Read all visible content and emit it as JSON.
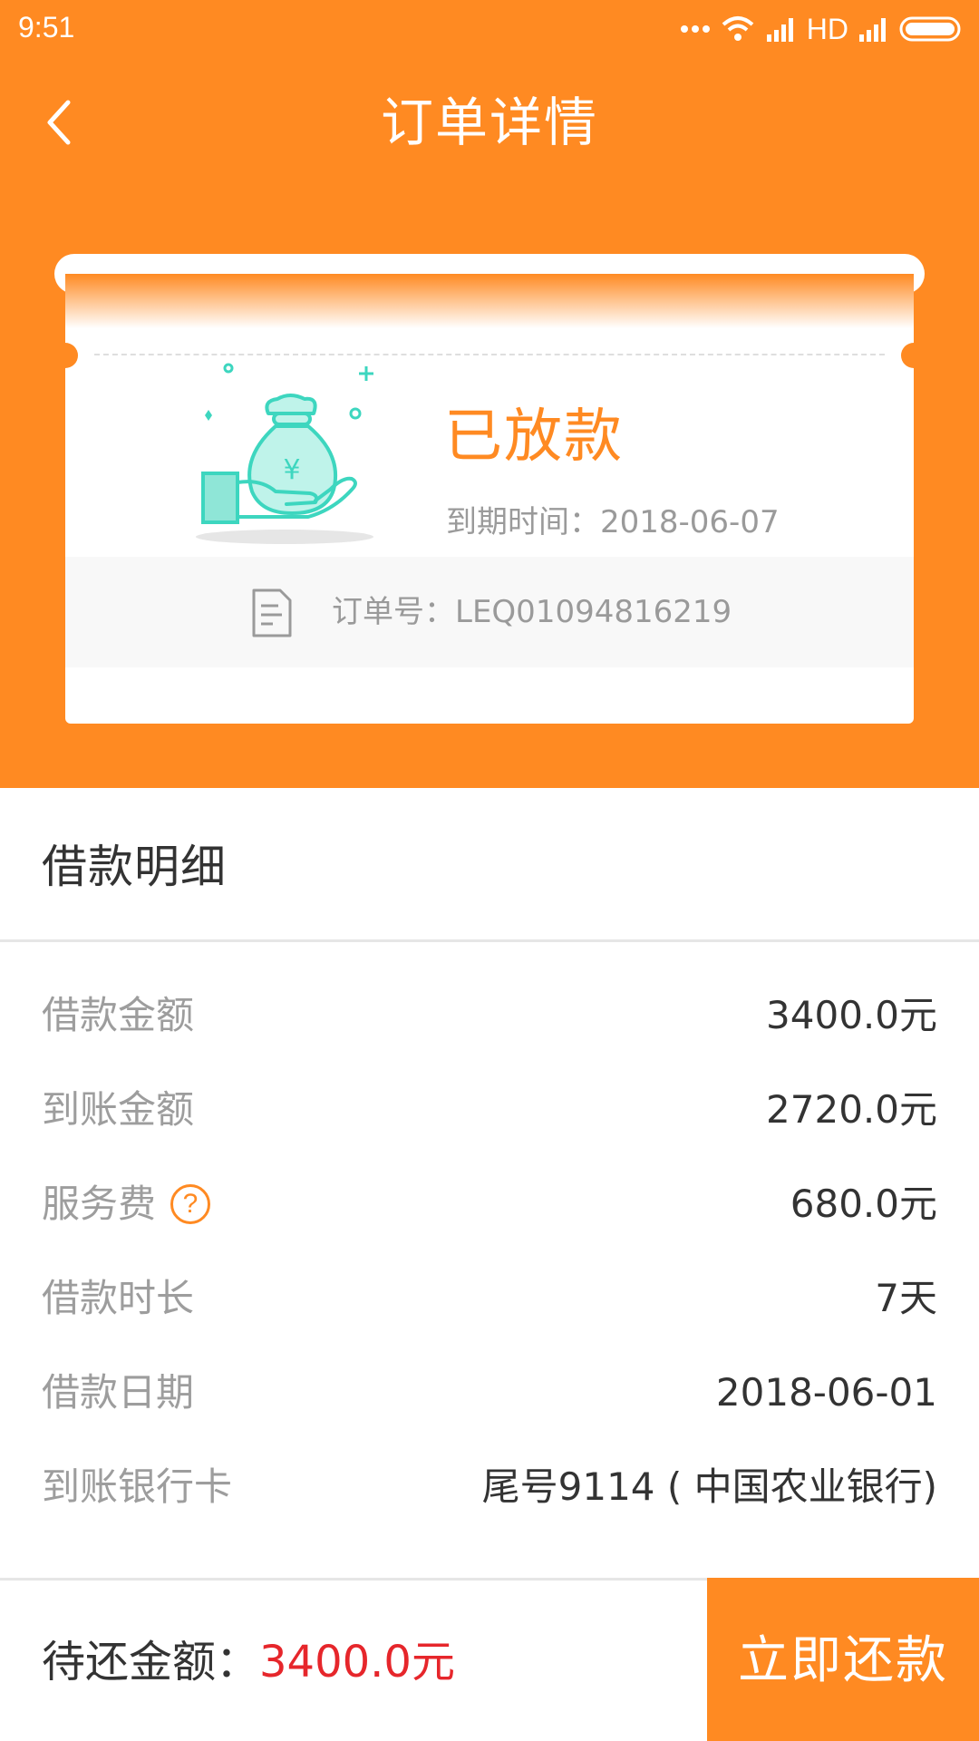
{
  "status_bar": {
    "time": "9:51",
    "network": "HD"
  },
  "nav": {
    "title": "订单详情"
  },
  "ticket": {
    "status": "已放款",
    "due_label": "到期时间：",
    "due_date": "2018-06-07",
    "order_label": "订单号：",
    "order_no": "LEQ01094816219"
  },
  "details": {
    "title": "借款明细",
    "rows": [
      {
        "label": "借款金额",
        "value": "3400.0元"
      },
      {
        "label": "到账金额",
        "value": "2720.0元"
      },
      {
        "label": "服务费",
        "value": "680.0元"
      },
      {
        "label": "借款时长",
        "value": "7天"
      },
      {
        "label": "借款日期",
        "value": "2018-06-01"
      },
      {
        "label": "到账银行卡",
        "value": "尾号9114 ( 中国农业银行)"
      }
    ]
  },
  "bottom": {
    "due_label": "待还金额：",
    "due_amount": "3400.0元",
    "repay_button": "立即还款"
  },
  "colors": {
    "accent": "#FF8A22",
    "amount_red": "#E6262B",
    "illustration_teal": "#3DD6BF"
  },
  "icons": {
    "back": "chevron-left-icon",
    "help": "question-circle-icon",
    "document": "document-icon",
    "illustration": "money-bag-hand-icon"
  }
}
